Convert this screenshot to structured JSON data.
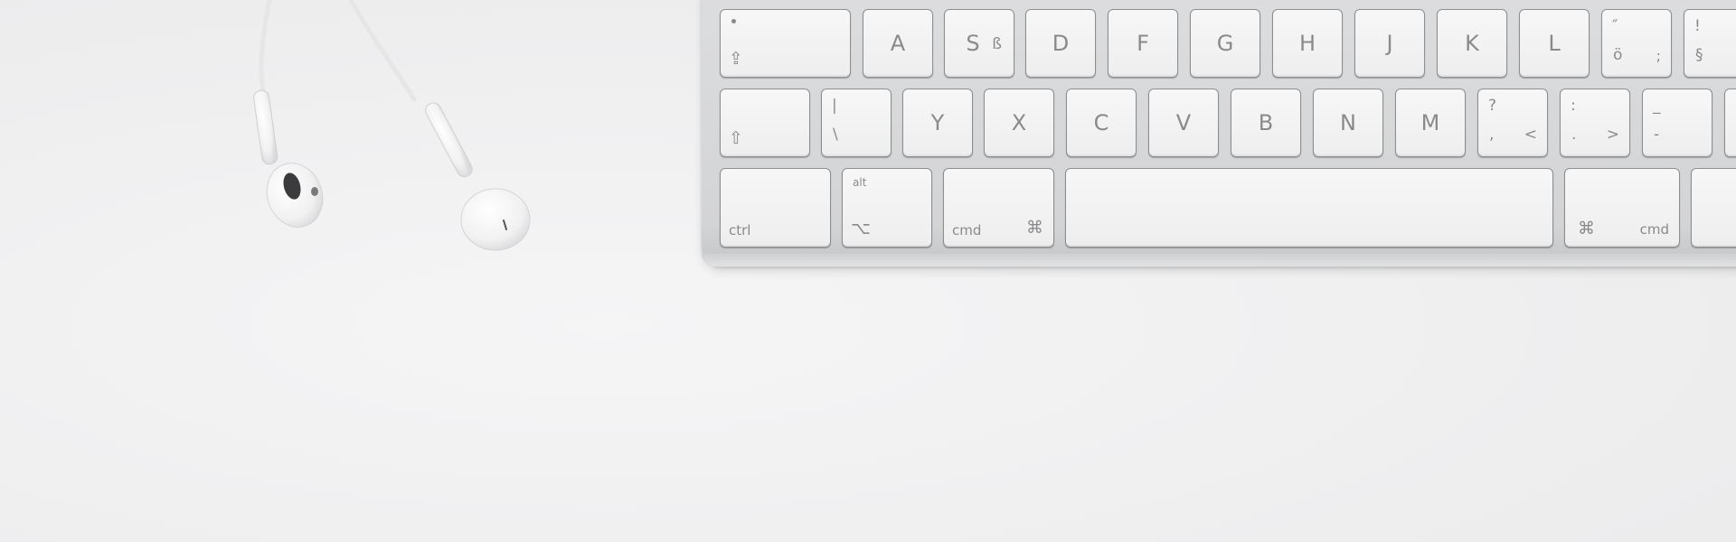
{
  "scene": {
    "background": "#efeff0",
    "key_text_color": "#8a8a8c",
    "keyboard_color": "#d8d9db"
  },
  "keys": {
    "caps": {
      "icon": "caps-lock-arrow-icon"
    },
    "row_home": [
      {
        "name": "key-a",
        "main": "A"
      },
      {
        "name": "key-s",
        "main": "S",
        "alt": "ß"
      },
      {
        "name": "key-d",
        "main": "D"
      },
      {
        "name": "key-f",
        "main": "F"
      },
      {
        "name": "key-g",
        "main": "G"
      },
      {
        "name": "key-h",
        "main": "H"
      },
      {
        "name": "key-j",
        "main": "J"
      },
      {
        "name": "key-k",
        "main": "K"
      },
      {
        "name": "key-l",
        "main": "L"
      }
    ],
    "quote_key": {
      "top": "″",
      "bottom": "ö",
      "right": ";"
    },
    "section_key": {
      "top": "!",
      "bottom": "§"
    },
    "shift": {
      "icon": "shift-arrow-icon"
    },
    "pipe_key": {
      "top": "|",
      "bottom": "\\"
    },
    "row_bottom": [
      {
        "name": "key-y",
        "main": "Y"
      },
      {
        "name": "key-x",
        "main": "X"
      },
      {
        "name": "key-c",
        "main": "C"
      },
      {
        "name": "key-v",
        "main": "V"
      },
      {
        "name": "key-b",
        "main": "B"
      },
      {
        "name": "key-n",
        "main": "N"
      },
      {
        "name": "key-m",
        "main": "M"
      }
    ],
    "comma_key": {
      "top": "?",
      "bottom": ",",
      "right": "<"
    },
    "period_key": {
      "top": ":",
      "bottom": ".",
      "right": ">"
    },
    "dash_key": {
      "top": "_",
      "bottom": "-"
    },
    "ctrl": {
      "label": "ctrl"
    },
    "alt": {
      "top": "alt",
      "glyph": "⌥"
    },
    "cmd_left": {
      "label": "cmd",
      "glyph": "⌘"
    },
    "space": {
      "label": ""
    },
    "cmd_right": {
      "label": "cmd",
      "glyph": "⌘"
    }
  }
}
